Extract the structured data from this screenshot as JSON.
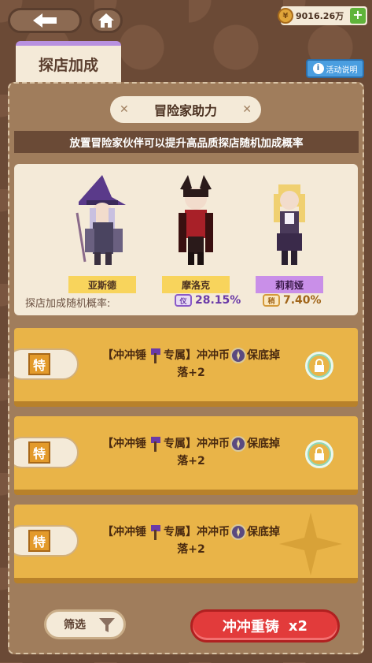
{
  "currency": {
    "amount": "9016.26万",
    "icon": "coin-icon",
    "add": "+"
  },
  "tab": {
    "label": "探店加成"
  },
  "help": {
    "label": "活动说明",
    "icon": "info-icon",
    "i": "i"
  },
  "section": {
    "title": "冒险家助力",
    "subtitle": "放置冒险家伙伴可以提升高品质探店随机加成概率"
  },
  "heroes": [
    {
      "name": "亚斯德",
      "rarity": "gold"
    },
    {
      "name": "摩洛克",
      "rarity": "gold"
    },
    {
      "name": "莉莉娅",
      "rarity": "purple"
    }
  ],
  "rates": {
    "label": "探店加成随机概率:",
    "purple_badge": "仪",
    "purple_value": "28.15%",
    "gold_badge": "稍",
    "gold_value": "7.40%"
  },
  "cards": [
    {
      "tag": "特",
      "line1a": "【冲冲锤",
      "line1b": "专属】冲冲币",
      "line1c": "保底掉",
      "line2": "落+2",
      "locked": true
    },
    {
      "tag": "特",
      "line1a": "【冲冲锤",
      "line1b": "专属】冲冲币",
      "line1c": "保底掉",
      "line2": "落+2",
      "locked": true
    },
    {
      "tag": "特",
      "line1a": "【冲冲锤",
      "line1b": "专属】冲冲币",
      "line1c": "保底掉",
      "line2": "落+2",
      "locked": false
    }
  ],
  "buttons": {
    "filter": "筛选",
    "reroll": "冲冲重铸",
    "reroll_count": "x2"
  },
  "colors": {
    "accent_gold": "#e9b448",
    "accent_red": "#e23b3b",
    "purple": "#b891e0"
  }
}
